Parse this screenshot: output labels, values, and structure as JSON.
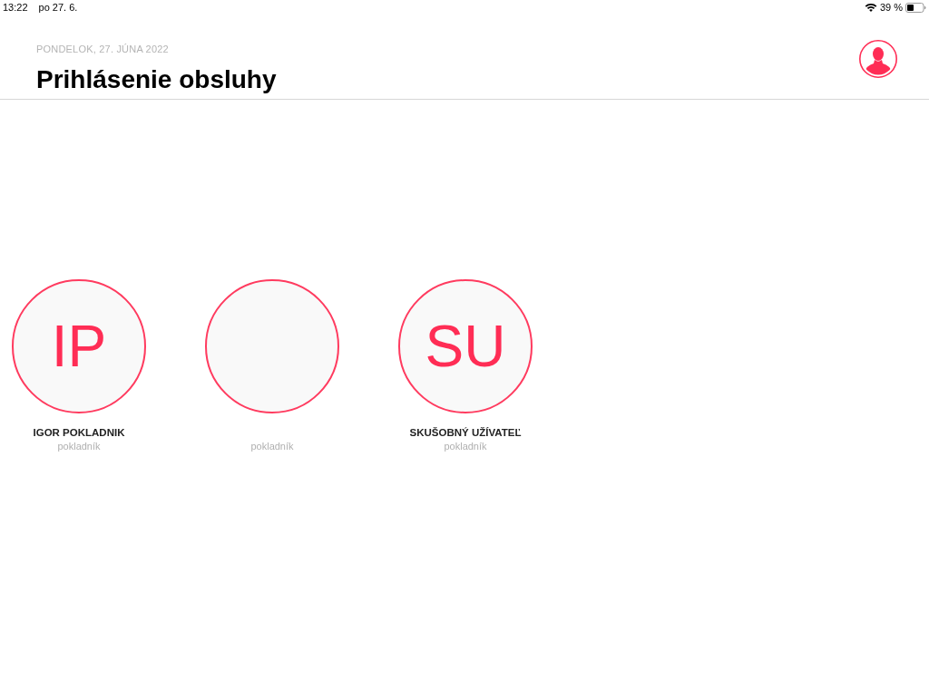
{
  "status_bar": {
    "time": "13:22",
    "date": "po 27. 6.",
    "battery_percent": "39 %"
  },
  "header": {
    "date": "PONDELOK, 27. JÚNA 2022",
    "title": "Prihlásenie obsluhy"
  },
  "users": [
    {
      "initials": "IP",
      "name": "IGOR POKLADNIK",
      "role": "pokladník"
    },
    {
      "role": "pokladník"
    },
    {
      "initials": "SU",
      "name": "SKUŠOBNÝ UŽÍVATEĽ",
      "role": "pokladník"
    }
  ]
}
